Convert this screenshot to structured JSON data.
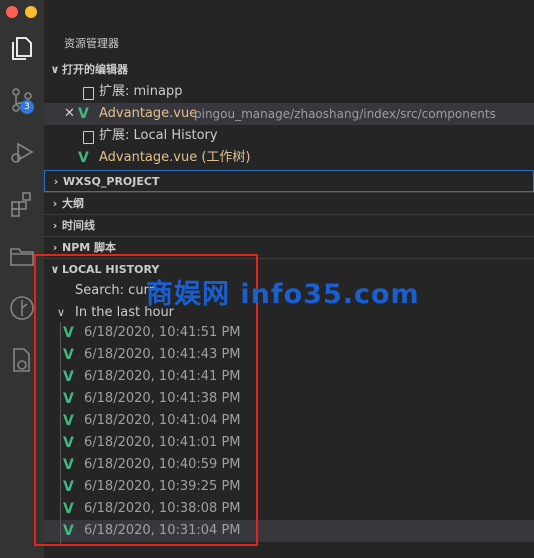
{
  "explorer": {
    "title": "资源管理器"
  },
  "activity_bar": {
    "items": [
      "files-icon",
      "source-control-icon",
      "debug-icon",
      "extensions-icon",
      "folder-icon",
      "git-graph-icon",
      "remote-icon"
    ],
    "scm_badge": "3"
  },
  "open_editors": {
    "header": "打开的编辑器",
    "items": [
      {
        "label": "扩展: minapp",
        "path": ""
      },
      {
        "label": "Advantage.vue",
        "path": "pingou_manage/zhaoshang/index/src/components"
      },
      {
        "label": "扩展: Local History",
        "path": ""
      },
      {
        "label": "Advantage.vue (工作树)",
        "path": ""
      }
    ]
  },
  "sections": {
    "project": "WXSQ_PROJECT",
    "outline": "大纲",
    "timeline": "时间线",
    "npm": "NPM 脚本",
    "local_history": "LOCAL HISTORY"
  },
  "local_history": {
    "search": "Search: curr",
    "group": "In the last hour",
    "entries": [
      "6/18/2020, 10:41:51 PM",
      "6/18/2020, 10:41:43 PM",
      "6/18/2020, 10:41:41 PM",
      "6/18/2020, 10:41:38 PM",
      "6/18/2020, 10:41:04 PM",
      "6/18/2020, 10:41:01 PM",
      "6/18/2020, 10:40:59 PM",
      "6/18/2020, 10:39:25 PM",
      "6/18/2020, 10:38:08 PM",
      "6/18/2020, 10:31:04 PM"
    ]
  },
  "watermark": "商娱网 info35.com",
  "colors": {
    "vue_green": "#41b883",
    "highlight_red": "#e0261c",
    "modified_orange": "#e2c08d",
    "watermark_blue": "#1a5fd0"
  }
}
